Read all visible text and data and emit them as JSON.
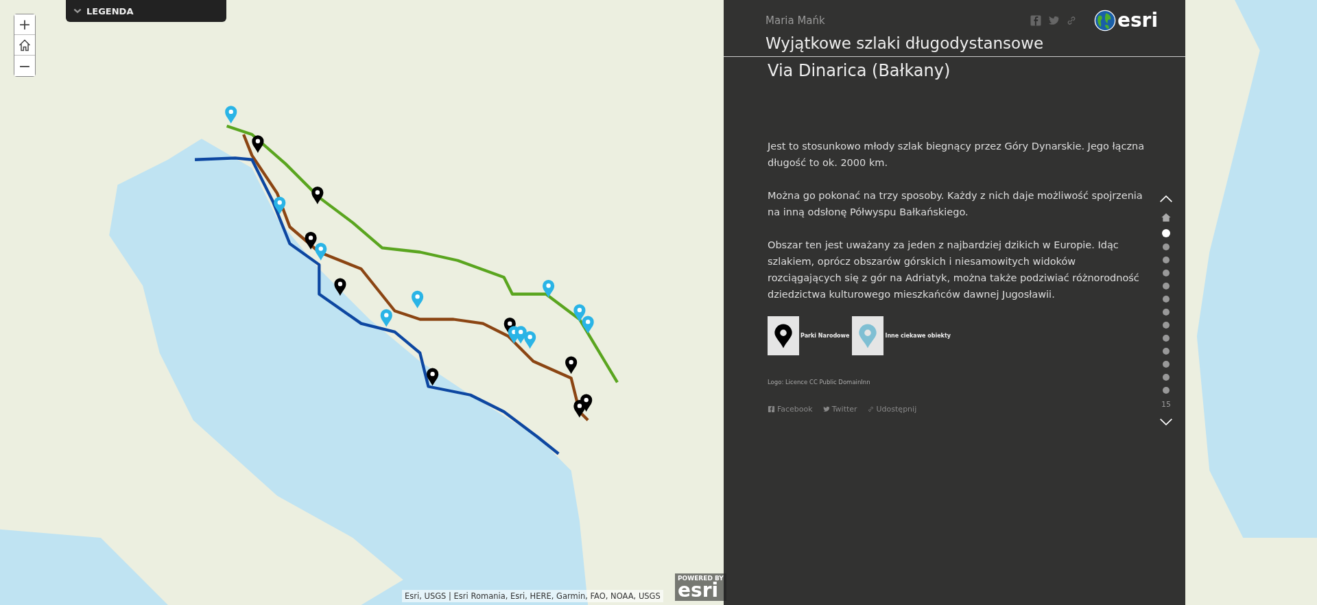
{
  "map": {
    "legend_button": {
      "label": "LEGENDA"
    },
    "zoom_in": "+",
    "zoom_out": "−",
    "attribution": "Esri, USGS | Esri Romania, Esri, HERE, Garmin, FAO, NOAA, USGS",
    "powered_by": "POWERED BY",
    "powered_logo": "esri"
  },
  "panel": {
    "author": "Maria Mańk",
    "logo": "esri",
    "title": "Wyjątkowe szlaki długodystansowe",
    "subtitle": "Via Dinarica (Bałkany)",
    "paragraphs": [
      "Jest to stosunkowo młody szlak biegnący przez Góry Dynarskie. Jego łączna długość to ok. 2000 km.",
      "Można go pokonać na trzy sposoby. Każdy z nich daje możliwość spojrzenia na inną odsłonę Półwyspu Bałkańskiego.",
      "Obszar ten jest uważany za jeden z najbardziej dzikich w Europie. Idąc szlakiem, oprócz obszarów górskich i niesamowitych widoków rozciągających się z gór na Adriatyk, można także podziwiać różnorodność dziedzictwa kulturowego mieszkańców dawnej Jugosławii."
    ],
    "legend": [
      {
        "label": "Parki Narodowe",
        "color": "#000000"
      },
      {
        "label": "Inne ciekawe obiekty",
        "color": "#7fbfd3"
      }
    ],
    "credit": "Logo: Licence CC Public DomainInn",
    "share_links": [
      {
        "kind": "facebook",
        "label": "Facebook"
      },
      {
        "kind": "twitter",
        "label": "Twitter"
      },
      {
        "kind": "link",
        "label": "Udostępnij"
      }
    ]
  },
  "navigation": {
    "dots": [
      {
        "selected": true
      },
      {
        "selected": false
      },
      {
        "selected": false
      },
      {
        "selected": false
      },
      {
        "selected": false
      },
      {
        "selected": false
      },
      {
        "selected": false
      },
      {
        "selected": false
      },
      {
        "selected": false
      },
      {
        "selected": false
      },
      {
        "selected": false
      },
      {
        "selected": false
      },
      {
        "selected": false
      }
    ],
    "count": "15"
  }
}
